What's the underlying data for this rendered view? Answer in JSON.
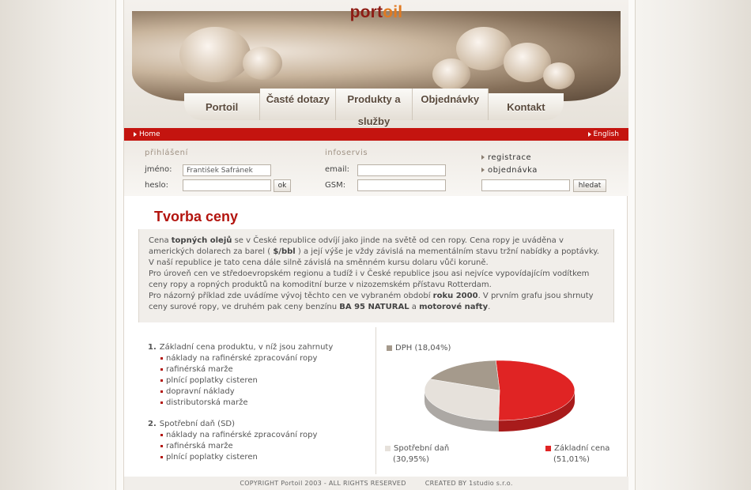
{
  "brand": {
    "logo_a": "port",
    "logo_b": "oil"
  },
  "nav": [
    "Portoil",
    "Časté dotazy",
    "Produkty a služby",
    "Objednávky",
    "Kontakt"
  ],
  "topbar": {
    "home": "Home",
    "lang": "English"
  },
  "login": {
    "title": "přihlášení",
    "name_label": "jméno:",
    "name_value": "František Šafránek",
    "pass_label": "heslo:",
    "ok": "ok"
  },
  "infoservis": {
    "title": "infoservis",
    "email_label": "email:",
    "gsm_label": "GSM:"
  },
  "links": {
    "register": "registrace",
    "order": "objednávka",
    "search_button": "hledat"
  },
  "content": {
    "title": "Tvorba ceny",
    "intro": {
      "p1_a": "Cena ",
      "p1_b": "topných olejů",
      "p1_c": " se v České republice odvíjí jako jinde na světě od cen ropy. Cena ropy je uváděna v amerických dolarech za barel ( ",
      "p1_d": "$/bbl",
      "p1_e": " ) a její výše je vždy závislá na mementálním stavu tržní nabídky a poptávky. V naší republice je tato cena dále silně závislá na směnném kursu dolaru vůči koruně.",
      "p2": "Pro úroveň cen ve středoevropském regionu a tudíž i v České republice jsou asi nejvíce vypovídajícím vodítkem ceny ropy a ropných produktů na komoditní burze v nizozemském přístavu Rotterdam.",
      "p3_a": "Pro názorný příklad zde uvádíme vývoj těchto cen ve vybraném období ",
      "p3_b": "roku 2000",
      "p3_c": ". V prvním grafu jsou shrnuty ceny surové ropy, ve druhém pak ceny benzínu ",
      "p3_d": "BA 95 NATURAL",
      "p3_e": " a ",
      "p3_f": "motorové nafty",
      "p3_g": "."
    },
    "list1": {
      "num": "1.",
      "title": "Základní cena produktu, v níž jsou zahrnuty",
      "items": [
        "náklady na rafinérské zpracování ropy",
        "rafinérská marže",
        "plnící poplatky cisteren",
        "dopravní náklady",
        "distributorská marže"
      ]
    },
    "list2": {
      "num": "2.",
      "title": "Spotřební daň (SD)",
      "items": [
        "náklady na rafinérské zpracování ropy",
        "rafinérská marže",
        "plnící poplatky cisteren"
      ]
    }
  },
  "chart_data": {
    "type": "pie",
    "slices": [
      {
        "label": "Základní cena",
        "pct_text": "(51,01%)",
        "value": 51.01,
        "color": "#e02424"
      },
      {
        "label": "Spotřební daň",
        "pct_text": "(30,95%)",
        "value": 30.95,
        "color": "#e6e1db"
      },
      {
        "label": "DPH",
        "pct_text": "(18,04%)",
        "value": 18.04,
        "color": "#a59a8c"
      }
    ]
  },
  "footer": {
    "copyright": "COPYRIGHT  Portoil 2003 - ALL RIGHTS RESERVED",
    "created": "CREATED BY 1studio s.r.o."
  }
}
